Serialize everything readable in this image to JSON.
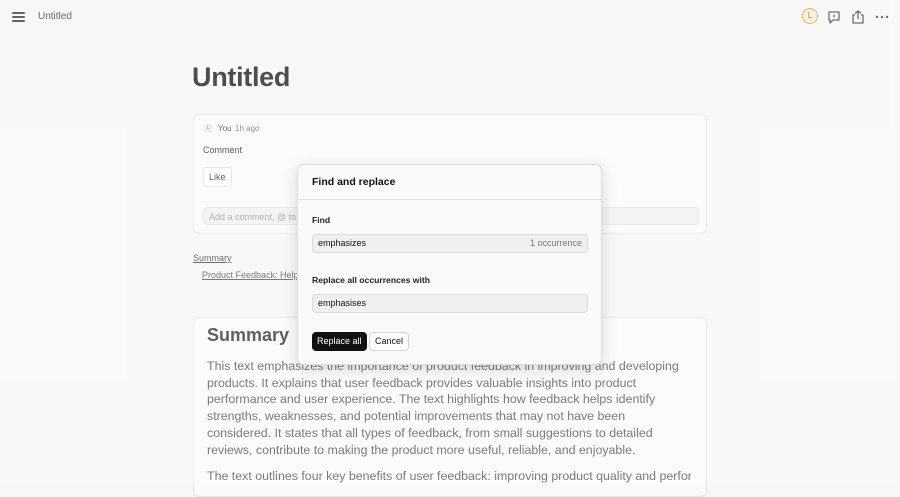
{
  "header": {
    "doc_tab": "Untitled",
    "avatar_letter": "L",
    "icons": [
      "menu-icon",
      "comment-icon",
      "share-icon",
      "more-icon"
    ]
  },
  "page": {
    "title": "Untitled"
  },
  "comment": {
    "avatar_letter": "L",
    "author": "You",
    "time": "1h ago",
    "body": "Comment",
    "like_label": "Like",
    "add_placeholder": "Add a comment, @ to"
  },
  "toc": {
    "title": "Summary",
    "item": "Product Feedback: Help"
  },
  "summary": {
    "heading": "Summary",
    "paragraph1": "This text emphasizes the importance of product feedback in improving and developing products. It explains that user feedback provides valuable insights into product performance and user experience. The text highlights how feedback helps identify strengths, weaknesses, and potential improvements that may not have been considered. It states that all types of feedback, from small suggestions to detailed reviews, contribute to making the product more useful, reliable, and enjoyable.",
    "paragraph2": "The text outlines four key benefits of user feedback: improving product quality and performance,"
  },
  "dialog": {
    "title": "Find and replace",
    "find_label": "Find",
    "find_value": "emphasizes",
    "occurrences": "1 occurrence",
    "replace_label": "Replace all occurrences with",
    "replace_value": "emphasises",
    "replace_all_label": "Replace all",
    "cancel_label": "Cancel"
  },
  "colors": {
    "accent_avatar": "#e3a23b",
    "primary_button": "#111111",
    "background": "#f7f7f7"
  }
}
